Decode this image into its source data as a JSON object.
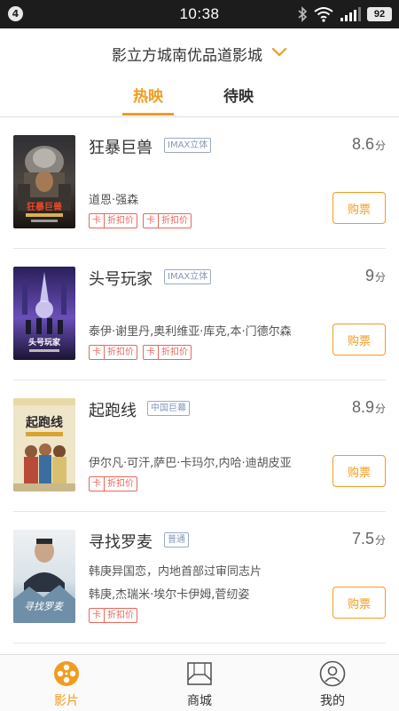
{
  "status_bar": {
    "notification_count": "4",
    "time": "10:38",
    "battery": "92",
    "icons": [
      "bluetooth-icon",
      "wifi-icon",
      "signal-icon",
      "battery-icon"
    ]
  },
  "header": {
    "cinema_name": "影立方城南优品道影城",
    "chevron_icon": "chevron-down-icon"
  },
  "tabs": [
    {
      "label": "热映",
      "active": true
    },
    {
      "label": "待映",
      "active": false
    }
  ],
  "movies": [
    {
      "title": "狂暴巨兽",
      "format": "IMAX立体",
      "score": "8.6",
      "score_unit": "分",
      "line1": "",
      "line2": "道恩·强森",
      "tags": [
        {
          "a": "卡",
          "b": "折扣价"
        },
        {
          "a": "卡",
          "b": "折扣价"
        }
      ],
      "buy_label": "购票"
    },
    {
      "title": "头号玩家",
      "format": "IMAX立体",
      "score": "9",
      "score_unit": "分",
      "line1": "",
      "line2": "泰伊·谢里丹,奥利维亚·库克,本·门德尔森",
      "tags": [
        {
          "a": "卡",
          "b": "折扣价"
        },
        {
          "a": "卡",
          "b": "折扣价"
        }
      ],
      "buy_label": "购票"
    },
    {
      "title": "起跑线",
      "format": "中国巨幕",
      "score": "8.9",
      "score_unit": "分",
      "line1": "",
      "line2": "伊尔凡·可汗,萨巴·卡玛尔,内哈·迪胡皮亚",
      "tags": [
        {
          "a": "卡",
          "b": "折扣价"
        }
      ],
      "buy_label": "购票"
    },
    {
      "title": "寻找罗麦",
      "format": "普通",
      "score": "7.5",
      "score_unit": "分",
      "line1": "韩庚异国恋，内地首部过审同志片",
      "line2": "韩庚,杰瑞米·埃尔卡伊姆,菅纫姿",
      "tags": [
        {
          "a": "卡",
          "b": "折扣价"
        }
      ],
      "buy_label": "购票"
    }
  ],
  "bottom_nav": [
    {
      "label": "影片",
      "icon": "film-reel-icon",
      "active": true
    },
    {
      "label": "商城",
      "icon": "store-icon",
      "active": false
    },
    {
      "label": "我的",
      "icon": "profile-icon",
      "active": false
    }
  ],
  "colors": {
    "accent": "#f29c1f",
    "tag": "#e6685a",
    "badge": "#8596bb"
  }
}
